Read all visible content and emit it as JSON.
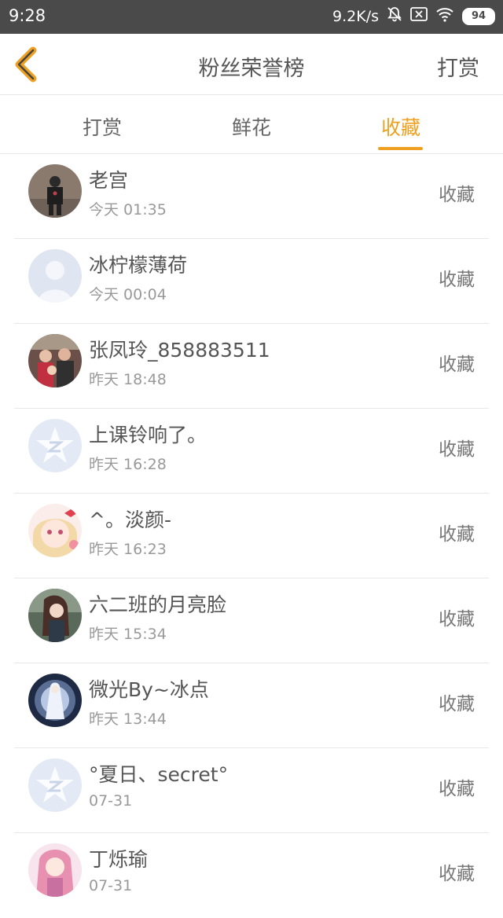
{
  "status": {
    "time": "9:28",
    "speed": "9.2K/s",
    "battery": "94"
  },
  "header": {
    "title": "粉丝荣誉榜",
    "action": "打赏"
  },
  "tabs": [
    {
      "label": "打赏"
    },
    {
      "label": "鲜花"
    },
    {
      "label": "收藏",
      "active": true
    }
  ],
  "colors": {
    "accent": "#f0a020",
    "status_bg": "#4a4a4a"
  },
  "items": [
    {
      "name": "老宫",
      "time": "今天 01:35",
      "action": "收藏"
    },
    {
      "name": "冰柠檬薄荷",
      "time": "今天 00:04",
      "action": "收藏"
    },
    {
      "name": "张凤玲_858883511",
      "time": "昨天 18:48",
      "action": "收藏"
    },
    {
      "name": "上课铃响了。",
      "time": "昨天 16:28",
      "action": "收藏"
    },
    {
      "name": "^。淡颜-",
      "time": "昨天 16:23",
      "action": "收藏"
    },
    {
      "name": "六二班的月亮脸",
      "time": "昨天 15:34",
      "action": "收藏"
    },
    {
      "name": "微光By~冰点",
      "time": "昨天 13:44",
      "action": "收藏"
    },
    {
      "name": "°夏日、secret°",
      "time": "07-31",
      "action": "收藏"
    },
    {
      "name": "丁烁瑜",
      "time": "07-31",
      "action": "收藏"
    }
  ]
}
